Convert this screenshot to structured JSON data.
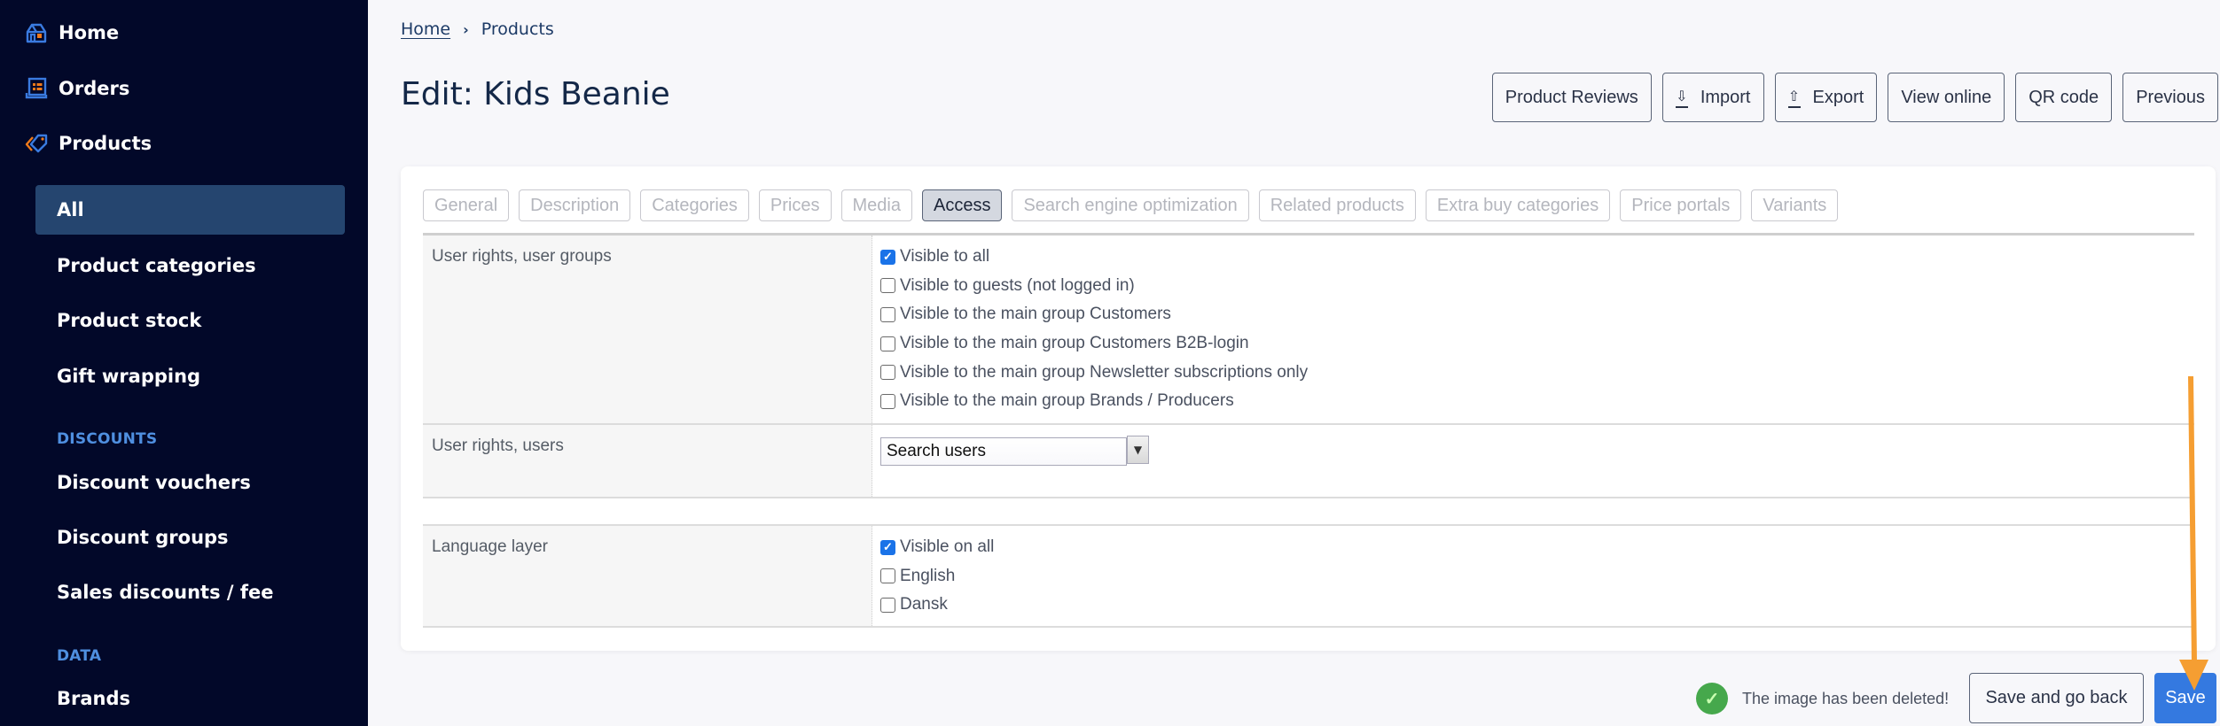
{
  "sidebar": {
    "top_items": [
      {
        "label": "Home",
        "icon": "home-icon"
      },
      {
        "label": "Orders",
        "icon": "orders-icon"
      },
      {
        "label": "Products",
        "icon": "tag-icon"
      }
    ],
    "products_sub": {
      "active": "All",
      "items": [
        "Product categories",
        "Product stock",
        "Gift wrapping"
      ]
    },
    "sections": [
      {
        "title": "DISCOUNTS",
        "items": [
          "Discount vouchers",
          "Discount groups",
          "Sales discounts / fee"
        ]
      },
      {
        "title": "DATA",
        "items": [
          "Brands"
        ]
      }
    ],
    "colors": {
      "background": "#020829",
      "active": "#25456f",
      "section": "#4f8fe0",
      "icon_blue": "#3a7be0",
      "icon_orange": "#f07a1a"
    }
  },
  "breadcrumb": {
    "home": "Home",
    "separator": "›",
    "current": "Products"
  },
  "page_title": "Edit: Kids Beanie",
  "top_actions": [
    {
      "label": "Product Reviews",
      "icon": null
    },
    {
      "label": "Import",
      "icon": "import-icon"
    },
    {
      "label": "Export",
      "icon": "export-icon"
    },
    {
      "label": "View online",
      "icon": null
    },
    {
      "label": "QR code",
      "icon": null
    },
    {
      "label": "Previous",
      "icon": null
    }
  ],
  "tabs": [
    {
      "label": "General",
      "active": false
    },
    {
      "label": "Description",
      "active": false
    },
    {
      "label": "Categories",
      "active": false
    },
    {
      "label": "Prices",
      "active": false
    },
    {
      "label": "Media",
      "active": false
    },
    {
      "label": "Access",
      "active": true
    },
    {
      "label": "Search engine optimization",
      "active": false
    },
    {
      "label": "Related products",
      "active": false
    },
    {
      "label": "Extra buy categories",
      "active": false
    },
    {
      "label": "Price portals",
      "active": false
    },
    {
      "label": "Variants",
      "active": false
    }
  ],
  "form": {
    "user_groups": {
      "label": "User rights, user groups",
      "options": [
        {
          "label": "Visible to all",
          "checked": true
        },
        {
          "label": "Visible to guests (not logged in)",
          "checked": false
        },
        {
          "label": "Visible to the main group Customers",
          "checked": false
        },
        {
          "label": "Visible to the main group Customers B2B-login",
          "checked": false
        },
        {
          "label": "Visible to the main group Newsletter subscriptions only",
          "checked": false
        },
        {
          "label": "Visible to the main group Brands / Producers",
          "checked": false
        }
      ]
    },
    "users": {
      "label": "User rights, users",
      "select_value": "Search users"
    },
    "language": {
      "label": "Language layer",
      "options": [
        {
          "label": "Visible on all",
          "checked": true
        },
        {
          "label": "English",
          "checked": false
        },
        {
          "label": "Dansk",
          "checked": false
        }
      ]
    }
  },
  "footer": {
    "status_message": "The image has been deleted!",
    "save_back_label": "Save and go back",
    "save_label": "Save",
    "colors": {
      "save": "#3479e0",
      "success": "#46a84c",
      "annotation_arrow": "#f59e32"
    }
  }
}
